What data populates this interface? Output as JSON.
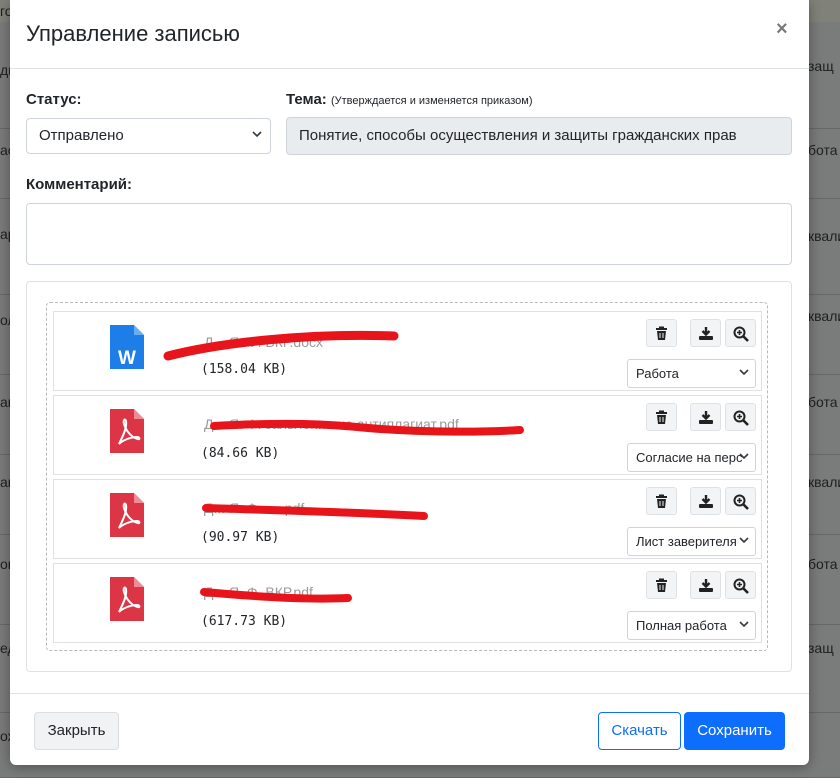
{
  "background": {
    "header_fragment": "го",
    "left_fragments": [
      "ди",
      "ас",
      "ар",
      "ол",
      "ав",
      "ак",
      "ов",
      "ед",
      "ох"
    ],
    "right_fragments": [
      "защ",
      "бота",
      "квали",
      "квали",
      "бота",
      "квали",
      "бота",
      "защ"
    ]
  },
  "modal": {
    "title": "Управление записью",
    "close_label": "×",
    "status": {
      "label": "Статус:",
      "value": "Отправлено"
    },
    "theme": {
      "label": "Тема:",
      "note": "(Утверждается и изменяется приказом)",
      "value": "Понятие, способы осуществления и защиты гражданских прав"
    },
    "comment": {
      "label": "Комментарий:",
      "value": ""
    },
    "files": [
      {
        "type": "word",
        "name": "Д... Я. Ф. ВКР.docx",
        "size": "(158.04 KB)",
        "category": "Работа"
      },
      {
        "type": "pdf",
        "name": "Д... Я. Ф. заявление на антиплагиат.pdf",
        "size": "(84.66 KB)",
        "category": "Согласие на перс"
      },
      {
        "type": "pdf",
        "name": "Д... Я. Ф. ... .pdf",
        "size": "(90.97 KB)",
        "category": "Лист заверителя"
      },
      {
        "type": "pdf",
        "name": "Д... Я. Ф. ВКР.pdf",
        "size": "(617.73 KB)",
        "category": "Полная работа"
      }
    ],
    "buttons": {
      "close": "Закрыть",
      "download": "Скачать",
      "save": "Сохранить"
    }
  },
  "colors": {
    "primary": "#0d6efd",
    "pdf_red": "#dc3545",
    "word_blue": "#1e7ee8",
    "redaction": "#e8141b"
  },
  "icons": [
    "close-icon",
    "chevron-down-icon",
    "word-file-icon",
    "pdf-file-icon",
    "trash-icon",
    "download-icon",
    "zoom-in-icon"
  ]
}
